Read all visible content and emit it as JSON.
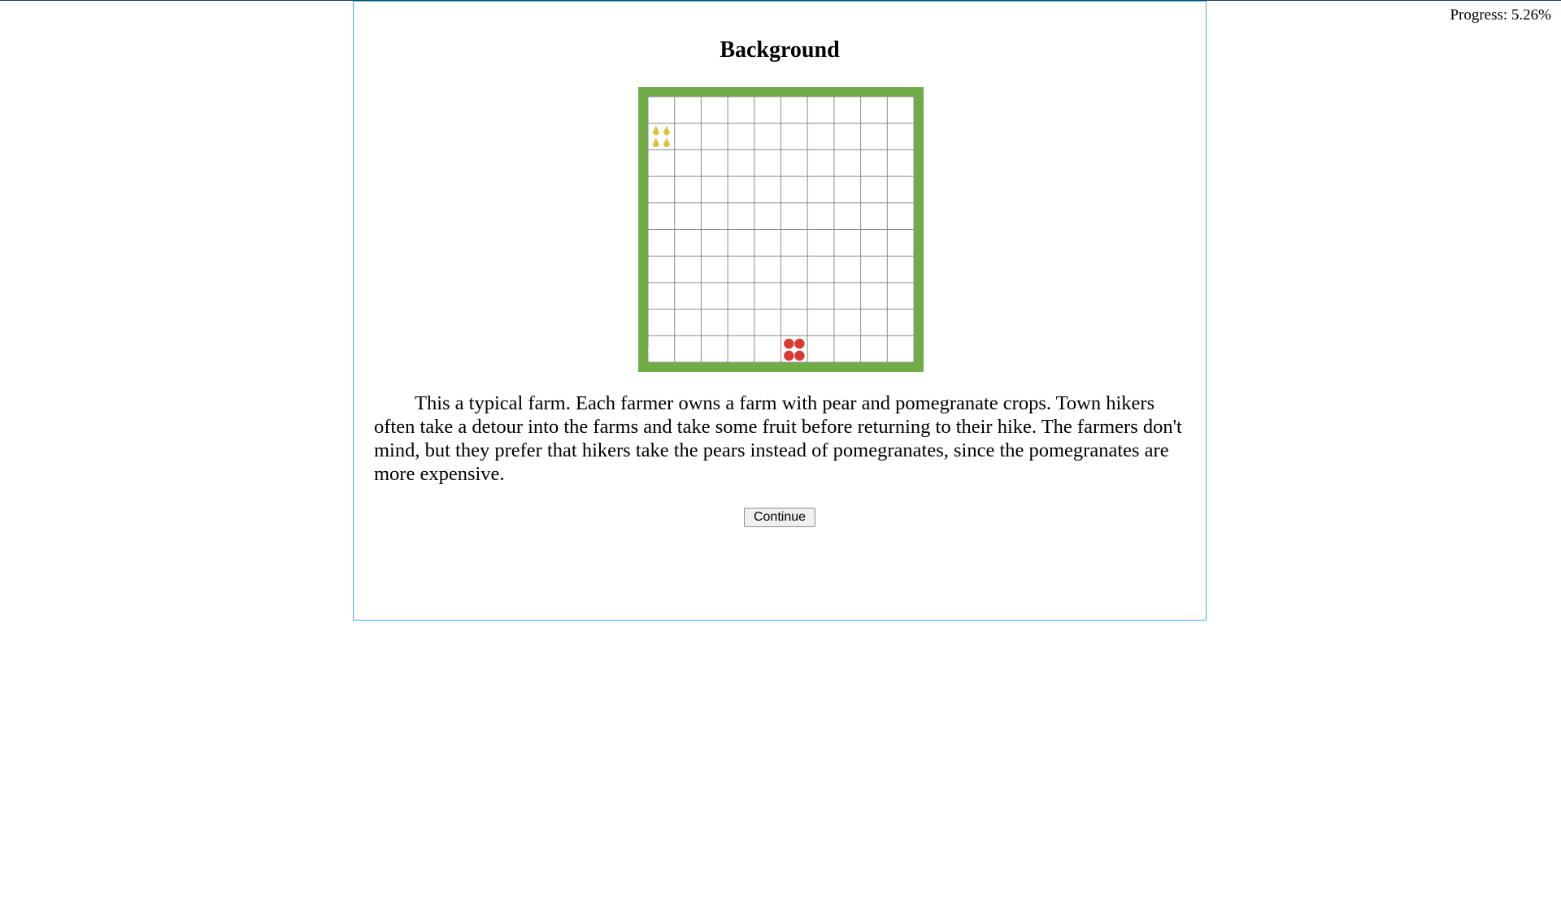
{
  "progress": {
    "label": "Progress: 5.26%"
  },
  "page": {
    "title": "Background",
    "description": "This a typical farm. Each farmer owns a farm with pear and pomegranate crops. Town hikers often take a detour into the farms and take some fruit before returning to their hike. The farmers don't mind, but they prefer that hikers take the pears instead of pomegranates, since the pomegranates are more expensive.",
    "continue_label": "Continue"
  },
  "farm": {
    "rows": 10,
    "cols": 10,
    "border_color": "#70ad47",
    "grid_color": "#8c8c8c",
    "pear_color": "#d9c441",
    "pomegranate_color": "#d93a34",
    "path_color": "#f3e6b6",
    "crops": [
      {
        "type": "pear",
        "row": 2,
        "col": 1
      },
      {
        "type": "pomegranate",
        "row": 10,
        "col": 6
      }
    ]
  }
}
